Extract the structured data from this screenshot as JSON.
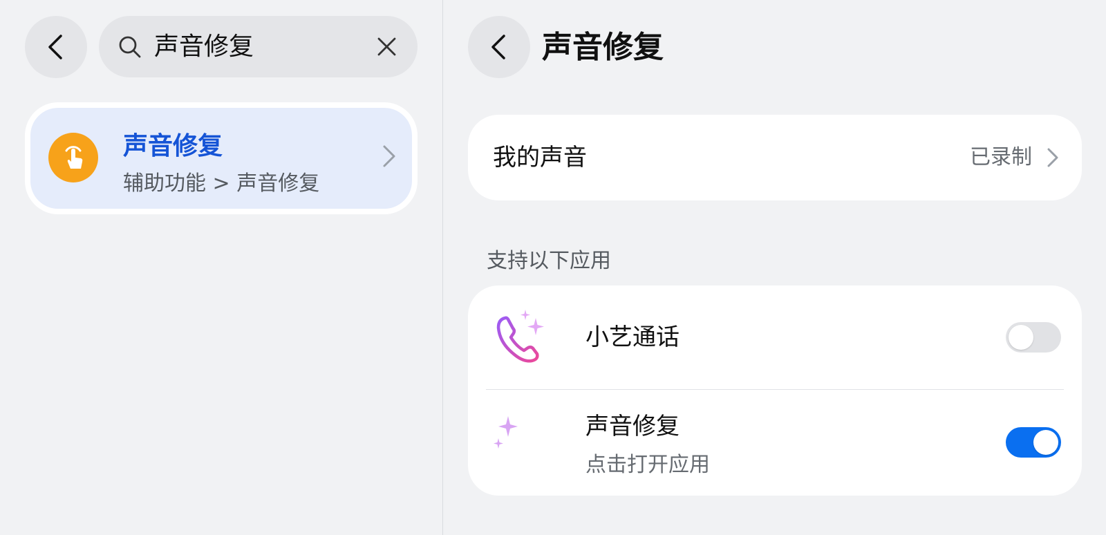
{
  "search": {
    "query": "声音修复"
  },
  "result": {
    "title": "声音修复",
    "path": "辅助功能 > 声音修复",
    "icon": "touch-hand-icon",
    "icon_color": "#f7a21a",
    "title_color": "#1554d6"
  },
  "detail": {
    "title": "声音修复",
    "my_voice": {
      "label": "我的声音",
      "status": "已录制"
    },
    "section_header": "支持以下应用",
    "apps": [
      {
        "name": "小艺通话",
        "subtitle": "",
        "enabled": false,
        "icon": "phone-sparkle-icon"
      },
      {
        "name": "声音修复",
        "subtitle": "点击打开应用",
        "enabled": true,
        "icon": "waveform-sparkle-icon"
      }
    ]
  },
  "colors": {
    "accent": "#0a6ff0",
    "background": "#f1f2f4",
    "card": "#ffffff",
    "selected_result_bg": "#e5ecfb"
  }
}
